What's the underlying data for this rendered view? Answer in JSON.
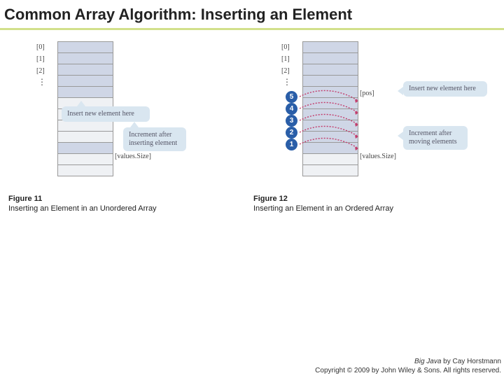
{
  "title": "Common Array Algorithm: Inserting an Element",
  "figA": {
    "fignum": "Figure 11",
    "caption": "Inserting an Element in an Unordered Array",
    "indices": [
      "[0]",
      "[1]",
      "[2]"
    ],
    "sizeLabel": "[values.Size]",
    "bubble1": "Insert new element here",
    "bubble2": "Increment after inserting element"
  },
  "figB": {
    "fignum": "Figure 12",
    "caption": "Inserting an Element in an Ordered Array",
    "indices": [
      "[0]",
      "[1]",
      "[2]"
    ],
    "posLabel": "[pos]",
    "sizeLabel": "[values.Size]",
    "bubble1": "Insert new element here",
    "bubble2": "Increment after moving elements",
    "dots": [
      "5",
      "4",
      "3",
      "2",
      "1"
    ]
  },
  "footer": {
    "line1_book": "Big Java",
    "line1_rest": " by Cay Horstmann",
    "line2": "Copyright © 2009 by John Wiley & Sons. All rights reserved."
  }
}
